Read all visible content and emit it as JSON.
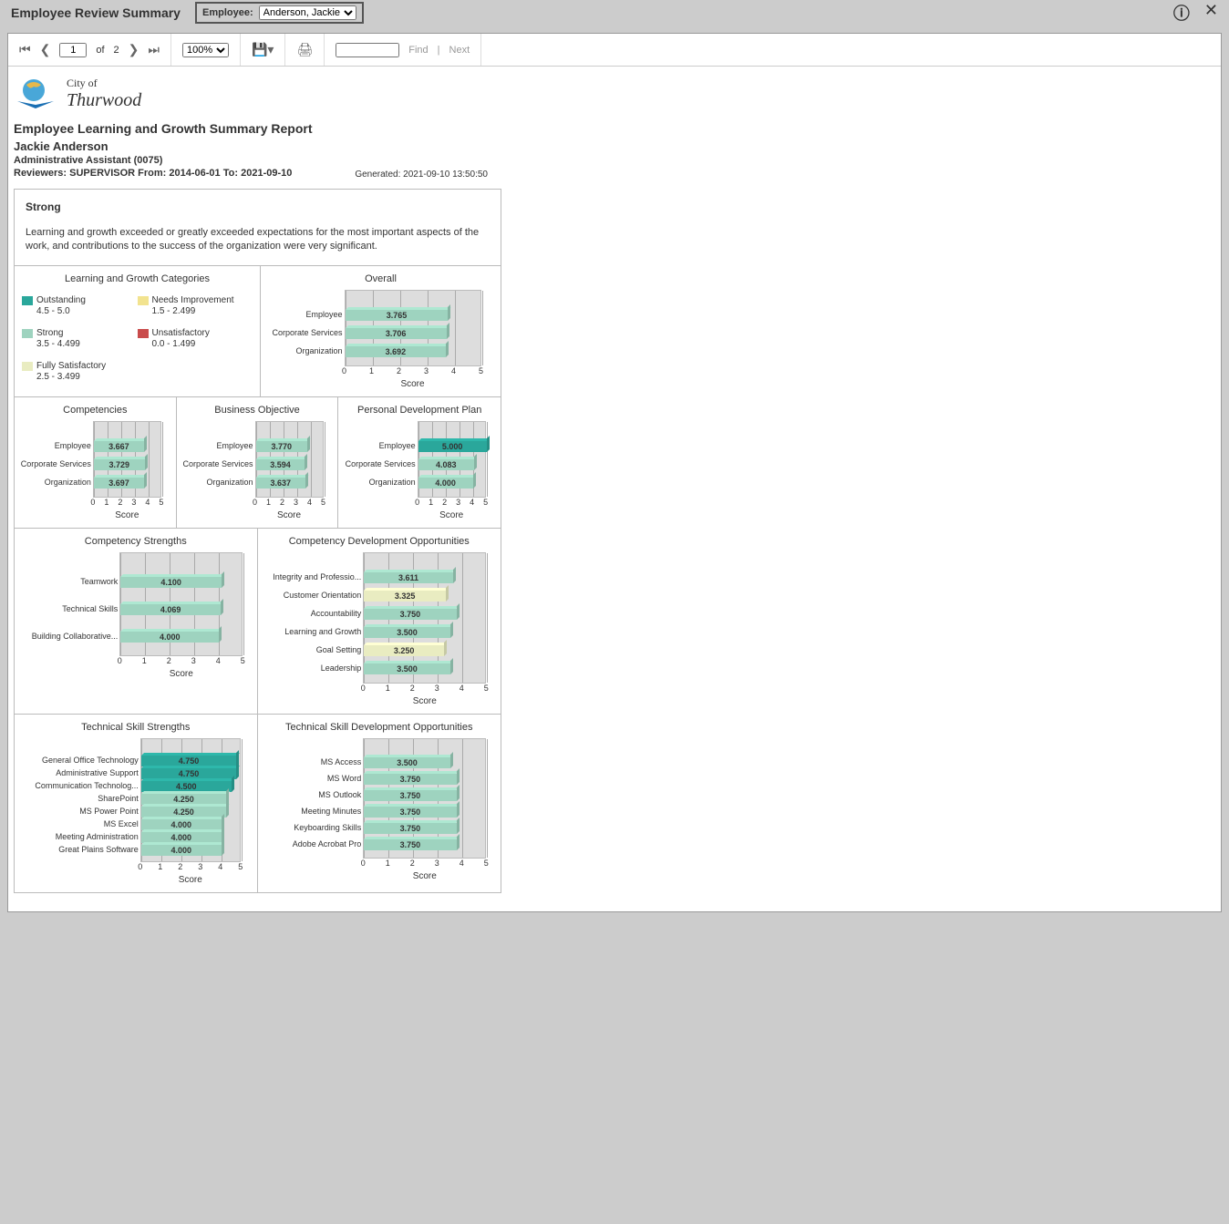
{
  "toolbar_header": {
    "title": "Employee Review Summary",
    "employee_label": "Employee:",
    "employee_value": "Anderson, Jackie",
    "help_icon": "?",
    "close_icon": "✕"
  },
  "viewer_toolbar": {
    "page_current": "1",
    "page_sep": "of",
    "page_total": "2",
    "zoom": "100%",
    "find_btn": "Find",
    "divider": "|",
    "next_btn": "Next"
  },
  "org": {
    "line1": "City of",
    "line2": "Thurwood"
  },
  "report": {
    "title": "Employee Learning and Growth Summary Report",
    "employee_name": "Jackie Anderson",
    "position": "Administrative Assistant (0075)",
    "rev_lbl": "Reviewers:",
    "rev_val": "SUPERVISOR",
    "from_lbl": "From:",
    "from_val": "2014-06-01",
    "to_lbl": "To:",
    "to_val": "2021-09-10",
    "generated": "Generated: 2021-09-10 13:50:50"
  },
  "assessment": {
    "heading": "Strong",
    "text": "Learning and growth exceeded or greatly exceeded expectations for the most important aspects of the work, and contributions to the success of the organization were very significant."
  },
  "legend": {
    "title": "Learning and Growth Categories",
    "items": [
      {
        "name": "Outstanding",
        "range": "4.5 - 5.0",
        "color": "#2aa79b"
      },
      {
        "name": "Needs Improvement",
        "range": "1.5 - 2.499",
        "color": "#f2e38f"
      },
      {
        "name": "Strong",
        "range": "3.5 - 4.499",
        "color": "#9ed3bf"
      },
      {
        "name": "Unsatisfactory",
        "range": "0.0 - 1.499",
        "color": "#c94b4b"
      },
      {
        "name": "Fully Satisfactory",
        "range": "2.5 - 3.499",
        "color": "#e9ecc1"
      }
    ]
  },
  "colors": {
    "outstanding": "#2aa79b",
    "strong": "#9ed3bf",
    "fully": "#e9ecc1"
  },
  "chart_data": [
    {
      "id": "overall",
      "type": "bar",
      "title": "Overall",
      "xlabel": "Score",
      "xlim": [
        0,
        5
      ],
      "ticks": [
        0,
        1,
        2,
        3,
        4,
        5
      ],
      "categories": [
        "Employee",
        "Corporate Services",
        "Organization"
      ],
      "values": [
        3.765,
        3.706,
        3.692
      ],
      "band": [
        "strong",
        "strong",
        "strong"
      ]
    },
    {
      "id": "competencies",
      "type": "bar",
      "title": "Competencies",
      "xlabel": "Score",
      "xlim": [
        0,
        5
      ],
      "ticks": [
        0,
        1,
        2,
        3,
        4,
        5
      ],
      "categories": [
        "Employee",
        "Corporate Services",
        "Organization"
      ],
      "values": [
        3.667,
        3.729,
        3.697
      ],
      "band": [
        "strong",
        "strong",
        "strong"
      ]
    },
    {
      "id": "busobj",
      "type": "bar",
      "title": "Business Objective",
      "xlabel": "Score",
      "xlim": [
        0,
        5
      ],
      "ticks": [
        0,
        1,
        2,
        3,
        4,
        5
      ],
      "categories": [
        "Employee",
        "Corporate Services",
        "Organization"
      ],
      "values": [
        3.77,
        3.594,
        3.637
      ],
      "band": [
        "strong",
        "strong",
        "strong"
      ]
    },
    {
      "id": "pdp",
      "type": "bar",
      "title": "Personal Development Plan",
      "xlabel": "Score",
      "xlim": [
        0,
        5
      ],
      "ticks": [
        0,
        1,
        2,
        3,
        4,
        5
      ],
      "categories": [
        "Employee",
        "Corporate Services",
        "Organization"
      ],
      "values": [
        5.0,
        4.083,
        4.0
      ],
      "band": [
        "outstanding",
        "strong",
        "strong"
      ]
    },
    {
      "id": "comp_str",
      "type": "bar",
      "title": "Competency Strengths",
      "xlabel": "Score",
      "xlim": [
        0,
        5
      ],
      "ticks": [
        0,
        1,
        2,
        3,
        4,
        5
      ],
      "categories": [
        "Teamwork",
        "Technical Skills",
        "Building Collaborative..."
      ],
      "values": [
        4.1,
        4.069,
        4.0
      ],
      "band": [
        "strong",
        "strong",
        "strong"
      ]
    },
    {
      "id": "comp_dev",
      "type": "bar",
      "title": "Competency Development Opportunities",
      "xlabel": "Score",
      "xlim": [
        0,
        5
      ],
      "ticks": [
        0,
        1,
        2,
        3,
        4,
        5
      ],
      "categories": [
        "Integrity and Professio...",
        "Customer Orientation",
        "Accountability",
        "Learning and Growth",
        "Goal Setting",
        "Leadership"
      ],
      "values": [
        3.611,
        3.325,
        3.75,
        3.5,
        3.25,
        3.5
      ],
      "band": [
        "strong",
        "fully",
        "strong",
        "strong",
        "fully",
        "strong"
      ]
    },
    {
      "id": "tech_str",
      "type": "bar",
      "title": "Technical Skill Strengths",
      "xlabel": "Score",
      "xlim": [
        0,
        5
      ],
      "ticks": [
        0,
        1,
        2,
        3,
        4,
        5
      ],
      "categories": [
        "General Office Technology",
        "Administrative Support",
        "Communication Technolog...",
        "SharePoint",
        "MS Power Point",
        "MS Excel",
        "Meeting Administration",
        "Great Plains Software"
      ],
      "values": [
        4.75,
        4.75,
        4.5,
        4.25,
        4.25,
        4.0,
        4.0,
        4.0
      ],
      "band": [
        "outstanding",
        "outstanding",
        "outstanding",
        "strong",
        "strong",
        "strong",
        "strong",
        "strong"
      ]
    },
    {
      "id": "tech_dev",
      "type": "bar",
      "title": "Technical Skill Development Opportunities",
      "xlabel": "Score",
      "xlim": [
        0,
        5
      ],
      "ticks": [
        0,
        1,
        2,
        3,
        4,
        5
      ],
      "categories": [
        "MS Access",
        "MS Word",
        "MS Outlook",
        "Meeting Minutes",
        "Keyboarding Skills",
        "Adobe Acrobat Pro"
      ],
      "values": [
        3.5,
        3.75,
        3.75,
        3.75,
        3.75,
        3.75
      ],
      "band": [
        "strong",
        "strong",
        "strong",
        "strong",
        "strong",
        "strong"
      ]
    }
  ]
}
